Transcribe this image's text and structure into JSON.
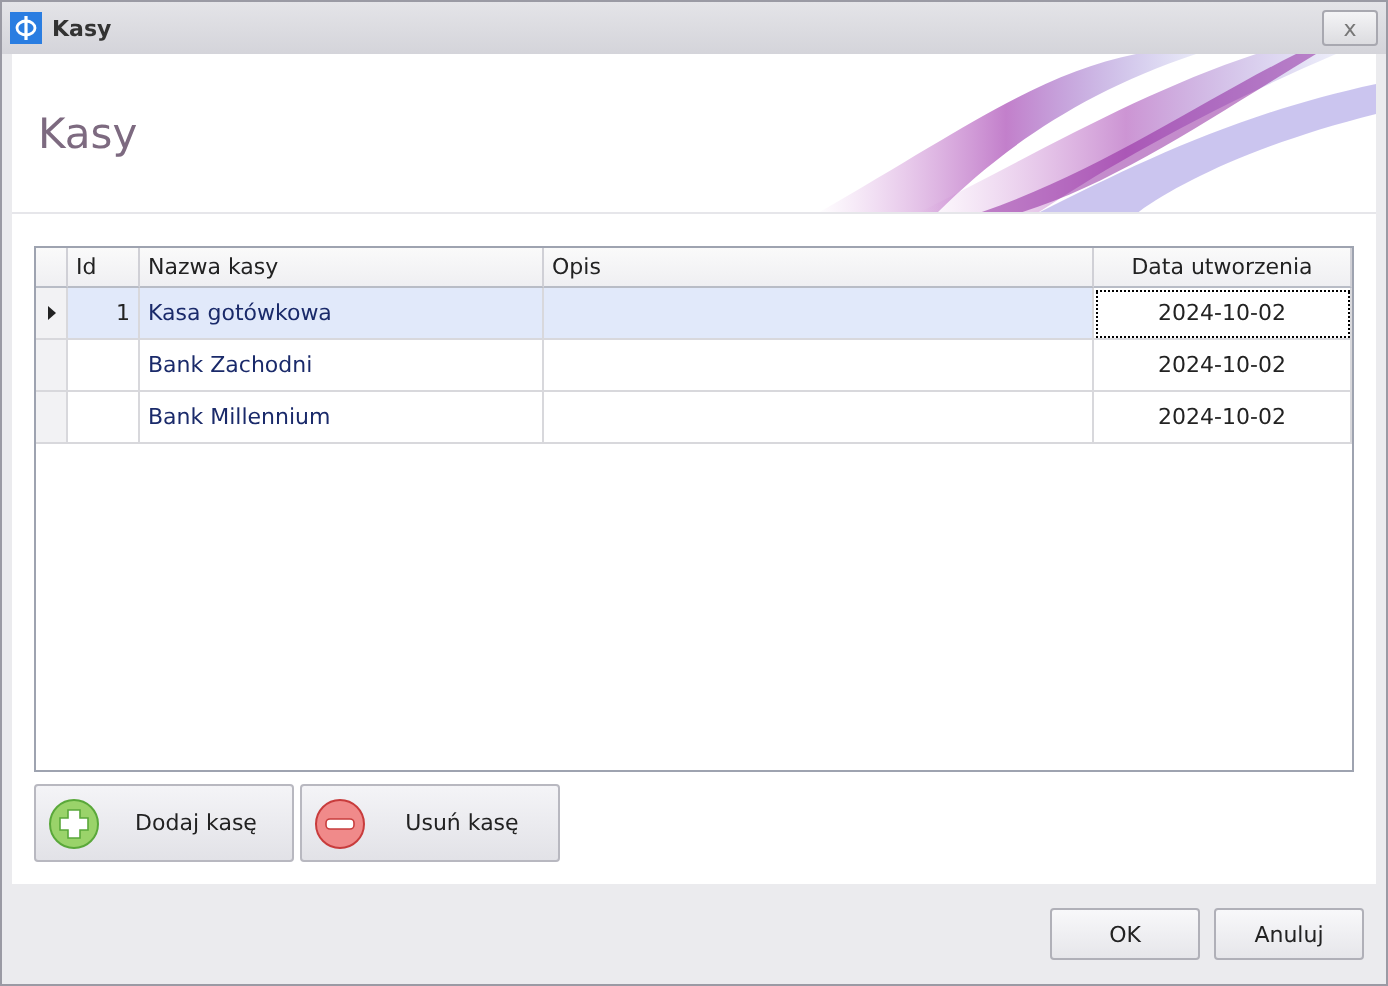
{
  "window": {
    "title": "Kasy",
    "close_symbol": "x"
  },
  "header": {
    "title": "Kasy"
  },
  "table": {
    "columns": [
      "Id",
      "Nazwa kasy",
      "Opis",
      "Data utworzenia"
    ],
    "rows": [
      {
        "id": "1",
        "name": "Kasa gotówkowa",
        "date": "2024-10-02",
        "selected": true
      },
      {
        "name": "Bank Zachodni",
        "date": "2024-10-02",
        "selected": false
      },
      {
        "name": "Bank Millennium",
        "date": "2024-10-02",
        "selected": false
      }
    ]
  },
  "actions": [
    {
      "kind": "add",
      "label": "Dodaj kasę"
    },
    {
      "kind": "remove",
      "label": "Usuń kasę"
    }
  ],
  "buttons": [
    "OK",
    "Anuluj"
  ]
}
